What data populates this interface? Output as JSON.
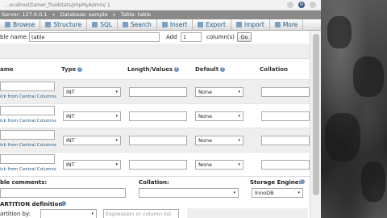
{
  "browser": {
    "url": "...ocalhost/tamer_fluidstats/phpMyAdmin/ 1",
    "avatar_letter": "N"
  },
  "breadcrumb": {
    "server": "Server: 127.0.0.1",
    "database": "Database: sample",
    "table": "Table: table"
  },
  "tabs": [
    {
      "label": "Browse",
      "icon": "browse-icon"
    },
    {
      "label": "Structure",
      "icon": "structure-icon"
    },
    {
      "label": "SQL",
      "icon": "sql-icon"
    },
    {
      "label": "Search",
      "icon": "search-icon"
    },
    {
      "label": "Insert",
      "icon": "insert-icon"
    },
    {
      "label": "Export",
      "icon": "export-icon"
    },
    {
      "label": "Import",
      "icon": "import-icon"
    },
    {
      "label": "More",
      "icon": "chevron-down-icon"
    }
  ],
  "table_form": {
    "name_label": "ble name:",
    "name_value": "table",
    "add_label": "Add",
    "add_value": "1",
    "columns_label": "column(s)",
    "go_label": "Go"
  },
  "columns_header": {
    "name": "ame",
    "type": "Type",
    "length": "Length/Values",
    "default": "Default",
    "collation": "Collation"
  },
  "rows": [
    {
      "type": "INT",
      "default": "None",
      "link": "ick from Central Columns"
    },
    {
      "type": "INT",
      "default": "None",
      "link": "ick from Central Columns"
    },
    {
      "type": "INT",
      "default": "None",
      "link": "ick from Central Columns"
    },
    {
      "type": "INT",
      "default": "None",
      "link": "ick from Central Columns"
    }
  ],
  "bottom": {
    "comments_label": "ble comments:",
    "collation_label": "Collation:",
    "engine_label": "Storage Engine:",
    "engine_value": "InnoDB",
    "partition_label": "ARTITION definition:",
    "partition_by_label": "artition by:",
    "expression_placeholder": "Expression or column list"
  },
  "colors": {
    "link": "#235a81",
    "breadcrumb_bg": "#8a8a8a"
  }
}
